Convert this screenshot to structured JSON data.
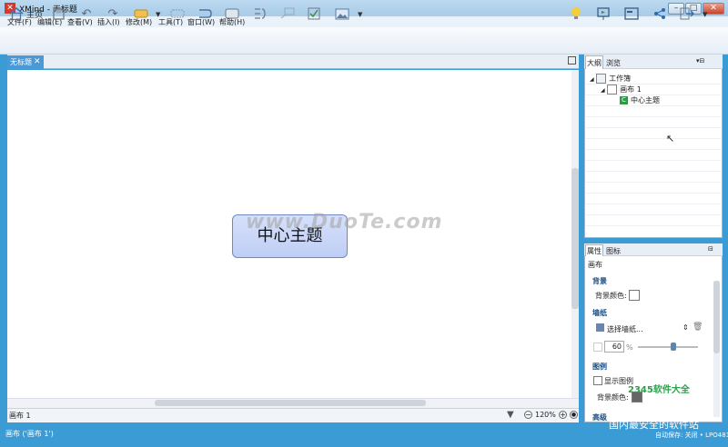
{
  "window": {
    "title": "XMind - 无标题",
    "logo": "✕"
  },
  "menu": [
    "文件(F)",
    "编辑(E)",
    "查看(V)",
    "插入(I)",
    "修改(M)",
    "工具(T)",
    "窗口(W)",
    "帮助(H)"
  ],
  "toolbar": {
    "home_label": "主页",
    "icons": [
      "home-icon",
      "save-icon",
      "undo-icon",
      "redo-icon",
      "topic-icon",
      "subtopic-icon",
      "relationship-icon",
      "boundary-icon",
      "summary-icon",
      "callout-icon",
      "task-icon",
      "image-icon",
      "idea-icon",
      "presentation-icon",
      "layout-icon",
      "share-icon",
      "export-icon"
    ]
  },
  "editor": {
    "tab_label": "无标题",
    "central_topic": "中心主题",
    "watermark": "www.DuoTe.com",
    "sheet_tab": "画布 1",
    "zoom": "120%"
  },
  "outline": {
    "tabs": [
      "大纲",
      "浏览"
    ],
    "tree": [
      {
        "label": "工作簿",
        "level": 0,
        "icon": "workbook-icon"
      },
      {
        "label": "画布 1",
        "level": 1,
        "icon": "sheet-icon"
      },
      {
        "label": "中心主题",
        "level": 2,
        "icon": "topic-node-icon"
      }
    ]
  },
  "properties": {
    "tabs": [
      "属性",
      "图标"
    ],
    "heading": "画布",
    "background_section": "背景",
    "background_color_label": "背景颜色:",
    "wallpaper_section": "墙纸",
    "wallpaper_select": "选择墙纸...",
    "opacity_value": "60",
    "opacity_unit": "%",
    "opacity_fraction": 0.6,
    "legend_section": "图例",
    "show_legend_label": "显示图例",
    "legend_bg_label": "背景颜色:",
    "advanced_section": "高级"
  },
  "status": {
    "left": "画布 ('画布 1')",
    "right": "自动保存: 关闭 • LPO481",
    "brand": "2345软件大全",
    "brand2": "国内最安全的软件站"
  }
}
